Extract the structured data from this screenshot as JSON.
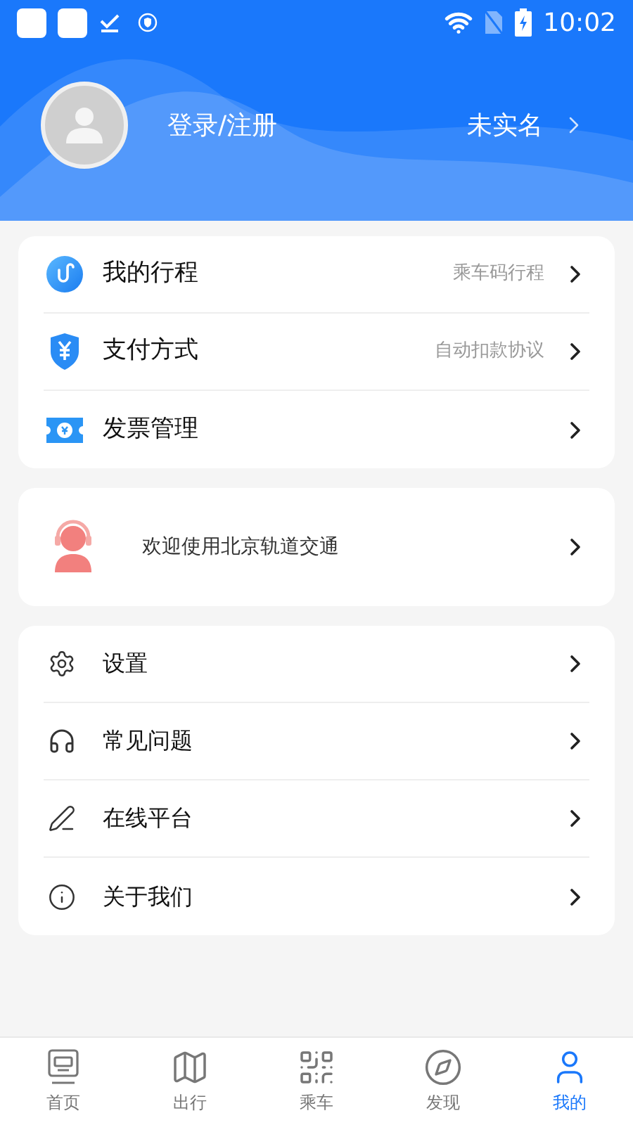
{
  "status_bar": {
    "time": "10:02"
  },
  "profile": {
    "login": "登录/注册",
    "verify": "未实名"
  },
  "main_menu": [
    {
      "kind": "trip",
      "label": "我的行程",
      "hint": "乘车码行程"
    },
    {
      "kind": "payment",
      "label": "支付方式",
      "hint": "自动扣款协议"
    },
    {
      "kind": "invoice",
      "label": "发票管理"
    }
  ],
  "welcome": {
    "text": "欢迎使用北京轨道交通"
  },
  "more_menu": [
    {
      "kind": "settings",
      "label": "设置"
    },
    {
      "kind": "faq",
      "label": "常见问题"
    },
    {
      "kind": "online",
      "label": "在线平台"
    },
    {
      "kind": "about",
      "label": "关于我们"
    }
  ],
  "tabs": [
    {
      "kind": "home",
      "label": "首页",
      "selected": false
    },
    {
      "kind": "travel",
      "label": "出行",
      "selected": false
    },
    {
      "kind": "ride",
      "label": "乘车",
      "selected": false
    },
    {
      "kind": "discover",
      "label": "发现",
      "selected": false
    },
    {
      "kind": "mine",
      "label": "我的",
      "selected": true
    }
  ]
}
